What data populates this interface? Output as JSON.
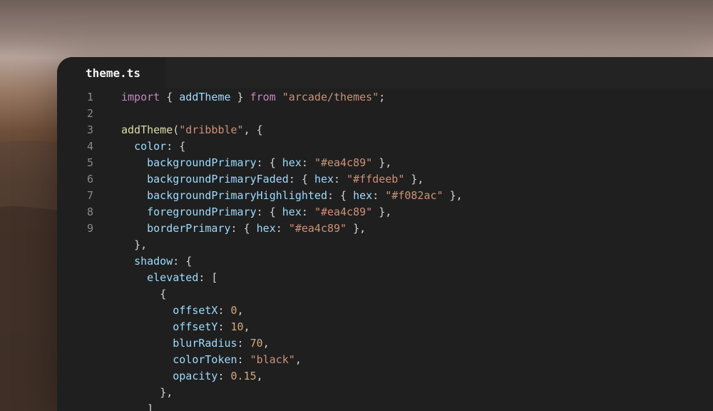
{
  "colors": {
    "editor_bg": "#1f1f1f",
    "tabbar_bg": "#232323",
    "keyword": "#c586c0",
    "function": "#dcdcaa",
    "identifier": "#9cdcfe",
    "string": "#ce9178",
    "number": "#d7a87a",
    "line_number": "#8a8a8a"
  },
  "editor": {
    "tab": {
      "label": "theme.ts"
    },
    "line_numbers": [
      "1",
      "2",
      "3",
      "4",
      "5",
      "6",
      "7",
      "8",
      "9"
    ],
    "code": {
      "l1": {
        "import": "import",
        "open": " { ",
        "name": "addTheme",
        "close": " } ",
        "from": "from",
        "space": " ",
        "path": "\"arcade/themes\"",
        "semi": ";"
      },
      "l3": {
        "fn": "addTheme",
        "open": "(",
        "arg": "\"dribbble\"",
        "rest": ", {"
      },
      "l4": {
        "key": "color",
        "rest": ": {"
      },
      "l5": {
        "key": "backgroundPrimary",
        "mid": ": { ",
        "hex": "hex",
        "colon": ": ",
        "val": "\"#ea4c89\"",
        "end": " },"
      },
      "l6": {
        "key": "backgroundPrimaryFaded",
        "mid": ": { ",
        "hex": "hex",
        "colon": ": ",
        "val": "\"#ffdeeb\"",
        "end": " },"
      },
      "l7": {
        "key": "backgroundPrimaryHighlighted",
        "mid": ": { ",
        "hex": "hex",
        "colon": ": ",
        "val": "\"#f082ac\"",
        "end": " },"
      },
      "l8": {
        "key": "foregroundPrimary",
        "mid": ": { ",
        "hex": "hex",
        "colon": ": ",
        "val": "\"#ea4c89\"",
        "end": " },"
      },
      "l9": {
        "key": "borderPrimary",
        "mid": ": { ",
        "hex": "hex",
        "colon": ": ",
        "val": "\"#ea4c89\"",
        "end": " },"
      },
      "l10": {
        "text": "},"
      },
      "l11": {
        "key": "shadow",
        "rest": ": {"
      },
      "l12": {
        "key": "elevated",
        "rest": ": ["
      },
      "l13": {
        "text": "{"
      },
      "l14": {
        "key": "offsetX",
        "colon": ": ",
        "val": "0",
        "end": ","
      },
      "l15": {
        "key": "offsetY",
        "colon": ": ",
        "val": "10",
        "end": ","
      },
      "l16": {
        "key": "blurRadius",
        "colon": ": ",
        "val": "70",
        "end": ","
      },
      "l17": {
        "key": "colorToken",
        "colon": ": ",
        "val": "\"black\"",
        "end": ","
      },
      "l18": {
        "key": "opacity",
        "colon": ": ",
        "val": "0.15",
        "end": ","
      },
      "l19": {
        "text": "},"
      },
      "l20": {
        "text": "]"
      }
    }
  }
}
